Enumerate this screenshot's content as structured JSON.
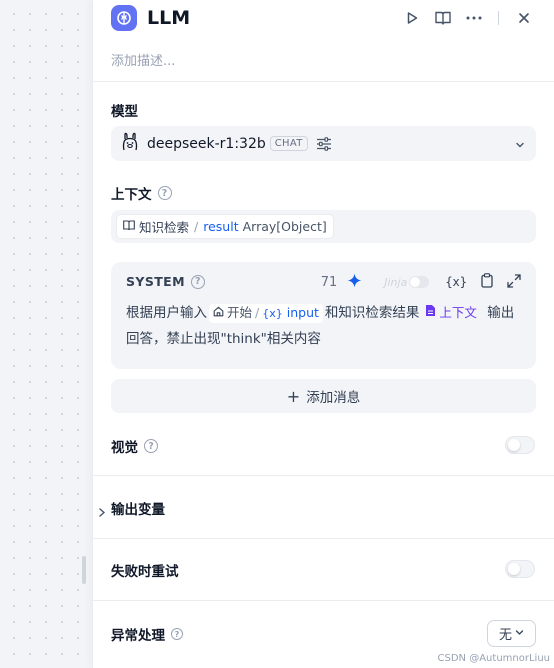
{
  "colors": {
    "accent": "#6172f3",
    "link": "#155eef",
    "context_purple": "#6938ef",
    "sparkle": "#155eef"
  },
  "header": {
    "title": "LLM",
    "node_icon": "brain-icon",
    "actions": [
      "play-icon",
      "book-icon",
      "more-icon",
      "close-icon"
    ]
  },
  "description_placeholder": "添加描述...",
  "model": {
    "label": "模型",
    "name": "deepseek-r1:32b",
    "mode_badge": "CHAT"
  },
  "context": {
    "label": "上下文",
    "variable": {
      "node": "知识检索",
      "name": "result",
      "type": "Array[Object]"
    }
  },
  "system_prompt": {
    "role": "SYSTEM",
    "char_count": "71",
    "jinja_label": "Jinja",
    "var_insert_label": "{x}",
    "segments": {
      "text1": "根据用户输入",
      "chip_node": "开始",
      "chip_var": "input",
      "text2": "和知识检索结果",
      "context_label": "上下文",
      "text3": "输出回答，禁止出现\"think\"相关内容"
    }
  },
  "add_message_label": "添加消息",
  "vision": {
    "label": "视觉",
    "enabled": false
  },
  "output_vars": {
    "label": "输出变量"
  },
  "retry": {
    "label": "失败时重试",
    "enabled": false
  },
  "error_handling": {
    "label": "异常处理",
    "value": "无"
  },
  "watermark": "CSDN @AutumnorLiuu"
}
